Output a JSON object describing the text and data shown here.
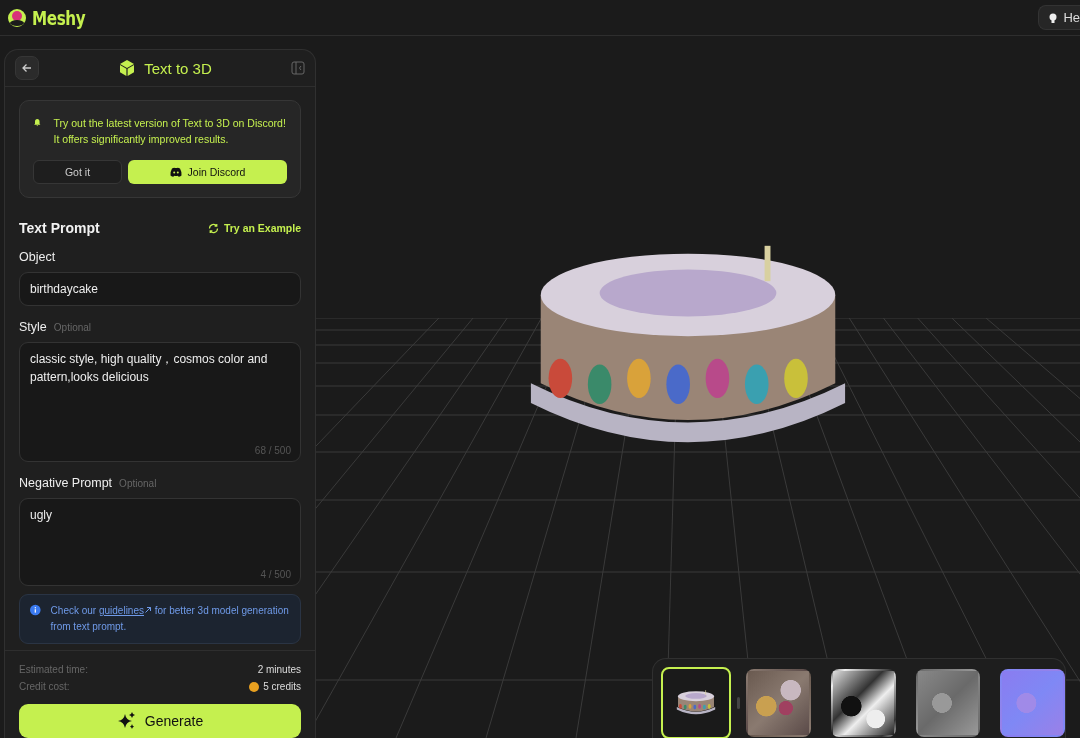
{
  "header": {
    "brand": "Meshy",
    "help_button": "He"
  },
  "panel": {
    "title": "Text to 3D",
    "notice": {
      "text": "Try out the latest version of Text to 3D on Discord! It offers significantly improved results.",
      "dismiss": "Got it",
      "join": "Join Discord"
    },
    "section_title": "Text Prompt",
    "example_link": "Try an Example",
    "fields": [
      {
        "kind": "input",
        "label": "Object",
        "value": "birthdaycake"
      },
      {
        "kind": "textarea",
        "label": "Style",
        "optional": "Optional",
        "value": "classic style, high quality，cosmos color and pattern,looks delicious",
        "counter": "68 / 500"
      },
      {
        "kind": "textarea",
        "label": "Negative Prompt",
        "optional": "Optional",
        "value": "ugly",
        "counter": "4 / 500"
      }
    ],
    "info": {
      "before": "Check our",
      "link": "guidelines",
      "after": "for better 3d model generation from text prompt."
    },
    "estimates": [
      {
        "label": "Estimated time:",
        "value": "2 minutes",
        "kind": "time"
      },
      {
        "label": "Credit cost:",
        "value": "5 credits",
        "kind": "credits"
      }
    ],
    "generate": "Generate"
  },
  "thumbnails": [
    {
      "kind": "preview",
      "selected": true
    },
    {
      "kind": "base-color",
      "selected": false
    },
    {
      "kind": "metallic",
      "selected": false
    },
    {
      "kind": "roughness",
      "selected": false
    },
    {
      "kind": "normal",
      "selected": false
    }
  ]
}
